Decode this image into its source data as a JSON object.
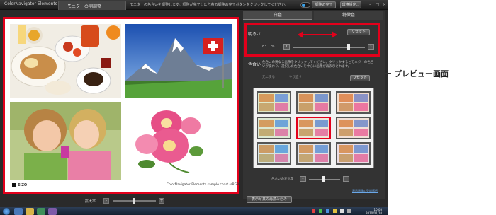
{
  "title_bar": {
    "app_name": "ColorNavigator Elements",
    "active_tab": "モニターの明調整",
    "instruction": "モニターの色合いを調整します。調整が完了したら右の調整の完了ボタンをクリックしてください。",
    "adjust_done_button": "調整の完了",
    "env_settings_button": "環境設定..."
  },
  "preview": {
    "brand": "EIZO",
    "sample_label": "ColorNavigator Elements sample chart (sRGB)",
    "zoom_label": "拡大率"
  },
  "panel": {
    "tabs": [
      "白色",
      "特徴色"
    ],
    "brightness_label": "明るさ",
    "reset_label": "リセット",
    "percent": "83.1 %",
    "color_label": "色合い",
    "color_description": "色合いの異なる画像をクリックしてください。クリックするとモニターの色合いが変わり、選択した色合いを中心に画像が再表示されます。",
    "small_buttons": [
      "元に戻る",
      "やり直す"
    ],
    "adjust_label": "色合いの変化量",
    "link": "表示画像の登録選択",
    "bottom_button": "表示写真の再読み込み"
  },
  "taskbar": {
    "time": "10:03",
    "date": "2010/01/10"
  },
  "callout": "プレビュー画面",
  "colors": {
    "highlight": "#e3001b",
    "app_bg": "#2a2a2a",
    "panel_bg": "#333333"
  },
  "icons": [
    "left-arrow-icon",
    "right-arrow-icon",
    "double-arrow-icon",
    "start-orb-icon"
  ]
}
